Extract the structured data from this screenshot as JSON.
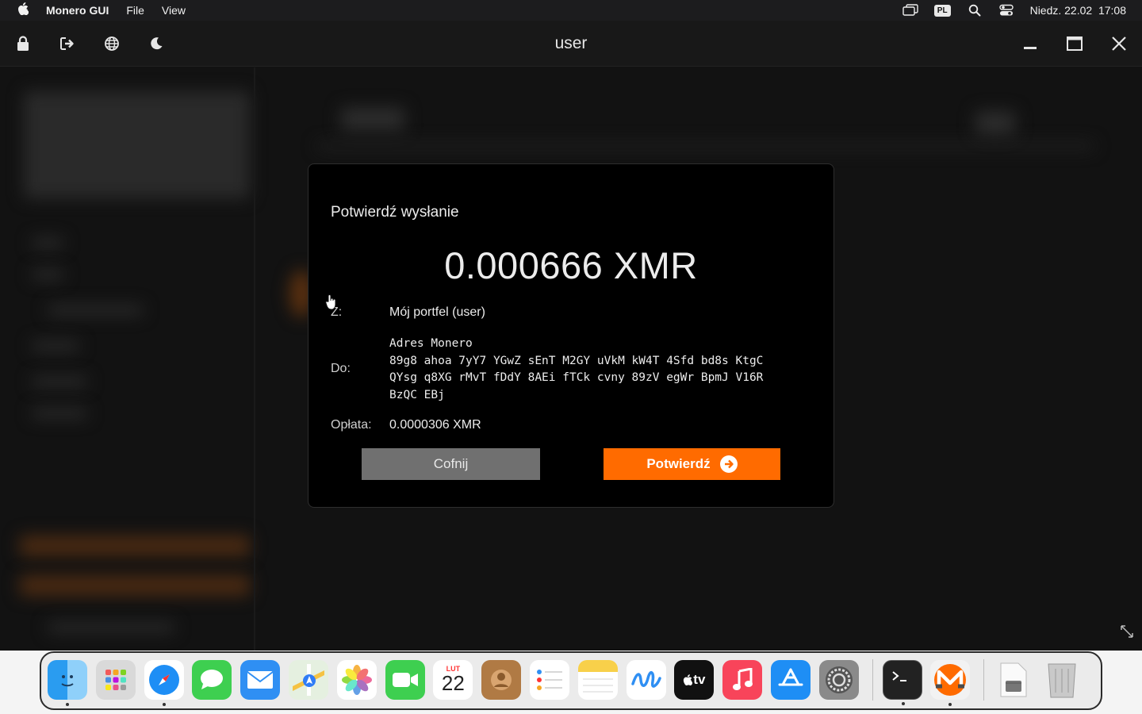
{
  "menubar": {
    "app_name": "Monero GUI",
    "menus": [
      "File",
      "View"
    ],
    "keyboard_layout": "PL",
    "datetime": "Niedz. 22.02  17:08"
  },
  "window": {
    "title": "user"
  },
  "dialog": {
    "title": "Potwierdź wysłanie",
    "amount": "0.000666 XMR",
    "from_label": "Z:",
    "from_value": "Mój portfel (user)",
    "to_label": "Do:",
    "address_type": "Adres Monero",
    "address_lines": [
      "89g8 ahoa 7yY7 YGwZ sEnT M2GY uVkM kW4T 4Sfd bd8s KtgC",
      "QYsg q8XG rMvT fDdY 8AEi fTCk cvny 89zV egWr BpmJ V16R",
      "BzQC EBj"
    ],
    "fee_label": "Opłata:",
    "fee_value": "0.0000306 XMR",
    "back_label": "Cofnij",
    "confirm_label": "Potwierdź"
  },
  "dock": {
    "calendar_month": "LUT",
    "calendar_day": "22",
    "tv_label": "tv"
  },
  "colors": {
    "accent": "#ff6b00",
    "back_button": "#707070",
    "dialog_bg": "#000000"
  }
}
